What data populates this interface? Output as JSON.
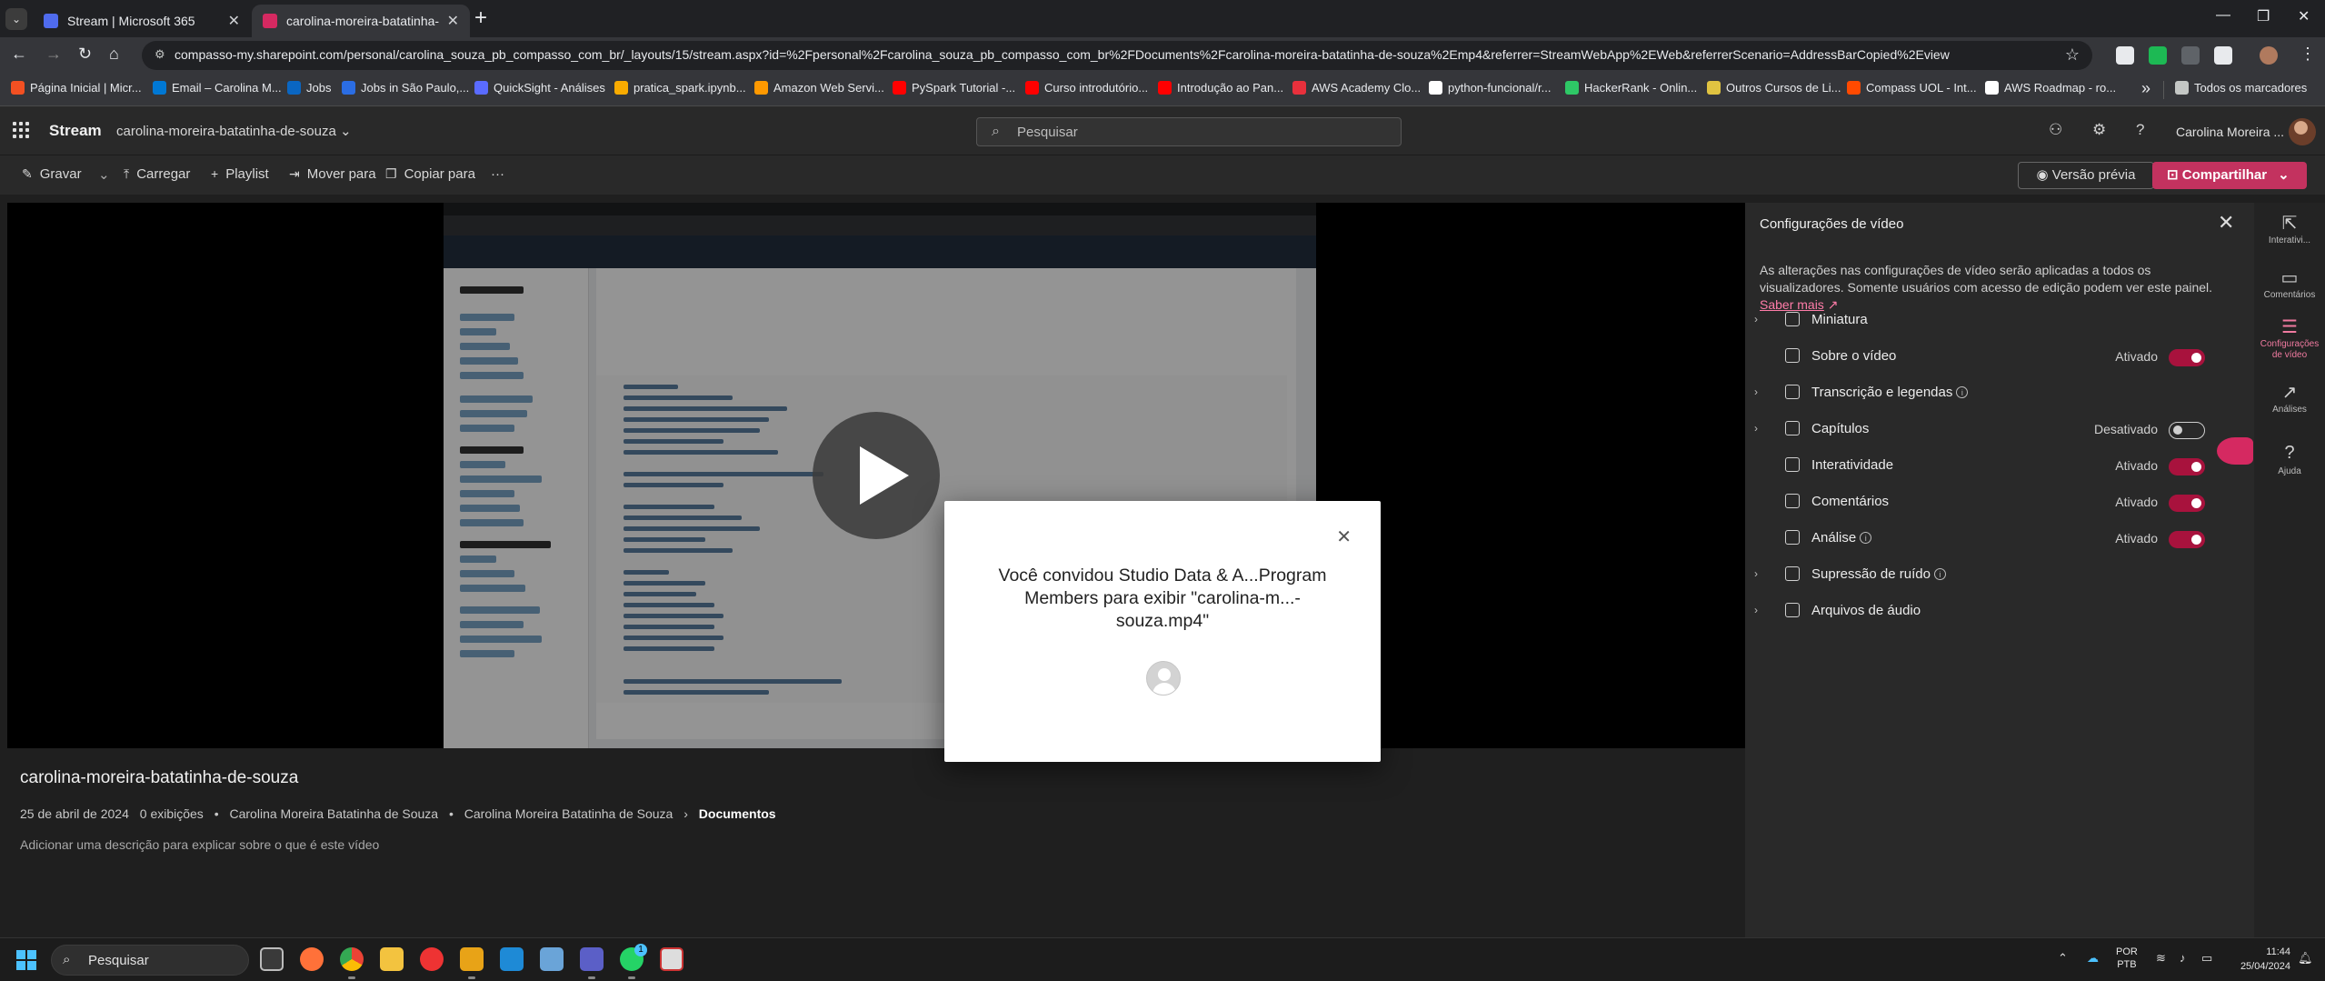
{
  "browser": {
    "tabs": [
      {
        "title": "Stream | Microsoft 365",
        "favicon_color": "#4f6bed"
      },
      {
        "title": "carolina-moreira-batatinha-de-souza",
        "favicon_color": "#d52961"
      }
    ],
    "url": "compasso-my.sharepoint.com/personal/carolina_souza_pb_compasso_com_br/_layouts/15/stream.aspx?id=%2Fpersonal%2Fcarolina_souza_pb_compasso_com_br%2FDocuments%2Fcarolina-moreira-batatinha-de-souza%2Emp4&referrer=StreamWebApp%2EWeb&referrerScenario=AddressBarCopied%2Eview",
    "bookmarks": [
      {
        "label": "Página Inicial | Micr...",
        "color": "#f25022"
      },
      {
        "label": "Email – Carolina M...",
        "color": "#0078d4"
      },
      {
        "label": "Jobs",
        "color": "#0a66c2"
      },
      {
        "label": "Jobs in São Paulo,...",
        "color": "#2b6de3"
      },
      {
        "label": "QuickSight - Análises",
        "color": "#5a6bff"
      },
      {
        "label": "pratica_spark.ipynb...",
        "color": "#f9ab00"
      },
      {
        "label": "Amazon Web Servi...",
        "color": "#ff9900"
      },
      {
        "label": "PySpark Tutorial -...",
        "color": "#ff0000"
      },
      {
        "label": "Curso introdutório...",
        "color": "#ff0000"
      },
      {
        "label": "Introdução ao Pan...",
        "color": "#ff0000"
      },
      {
        "label": "AWS Academy Clo...",
        "color": "#e8303c"
      },
      {
        "label": "python-funcional/r...",
        "color": "#ffffff"
      },
      {
        "label": "HackerRank - Onlin...",
        "color": "#2ec866"
      },
      {
        "label": "Outros Cursos de Li...",
        "color": "#e0c341"
      },
      {
        "label": "Compass UOL - Int...",
        "color": "#ff4a00"
      },
      {
        "label": "AWS Roadmap - ro...",
        "color": "#ffffff"
      }
    ],
    "bookmarks_all": "Todos os marcadores"
  },
  "stream": {
    "app_name": "Stream",
    "breadcrumb": "carolina-moreira-batatinha-de-souza",
    "search_placeholder": "Pesquisar",
    "user_name": "Carolina Moreira ...",
    "commands": [
      "Gravar",
      "Carregar",
      "Playlist",
      "Mover para",
      "Copiar para"
    ],
    "more": "···",
    "preview": "Versão prévia",
    "share": "Compartilhar"
  },
  "dialog": {
    "message": "Você convidou Studio Data & A...Program Members para exibir \"carolina-m...-souza.mp4\""
  },
  "video_info": {
    "title": "carolina-moreira-batatinha-de-souza",
    "date": "25 de abril de 2024",
    "views": "0 exibições",
    "author": "Carolina Moreira Batatinha de Souza",
    "path_owner": "Carolina Moreira Batatinha de Souza",
    "path_folder": "Documentos",
    "description_placeholder": "Adicionar uma descrição para explicar sobre o que é este vídeo"
  },
  "settings": {
    "title": "Configurações de vídeo",
    "description": "As alterações nas configurações de vídeo serão aplicadas a todos os visualizadores. Somente usuários com acesso de edição podem ver este painel.",
    "link": "Saber mais",
    "rows": [
      {
        "label": "Miniatura",
        "status": "",
        "toggle": "none",
        "expand": true
      },
      {
        "label": "Sobre o vídeo",
        "status": "Ativado",
        "toggle": "on",
        "expand": false
      },
      {
        "label": "Transcrição e legendas",
        "status": "",
        "toggle": "none",
        "expand": true,
        "info": true
      },
      {
        "label": "Capítulos",
        "status": "Desativado",
        "toggle": "off",
        "expand": true
      },
      {
        "label": "Interatividade",
        "status": "Ativado",
        "toggle": "on",
        "expand": false
      },
      {
        "label": "Comentários",
        "status": "Ativado",
        "toggle": "on",
        "expand": false
      },
      {
        "label": "Análise",
        "status": "Ativado",
        "toggle": "on",
        "expand": false,
        "info": true
      },
      {
        "label": "Supressão de ruído",
        "status": "",
        "toggle": "none",
        "expand": true,
        "info": true
      },
      {
        "label": "Arquivos de áudio",
        "status": "",
        "toggle": "none",
        "expand": true
      }
    ]
  },
  "rail": [
    {
      "label": "Interativi...",
      "icon": "interactivity-icon"
    },
    {
      "label": "Comentários",
      "icon": "comment-icon"
    },
    {
      "label": "Configurações de vídeo",
      "icon": "video-settings-icon"
    },
    {
      "label": "Análises",
      "icon": "analytics-icon"
    },
    {
      "label": "Ajuda",
      "icon": "help-icon"
    }
  ],
  "taskbar": {
    "search": "Pesquisar",
    "lang1": "POR",
    "lang2": "PTB",
    "time": "11:44",
    "date": "25/04/2024",
    "teams_badge": "1"
  }
}
